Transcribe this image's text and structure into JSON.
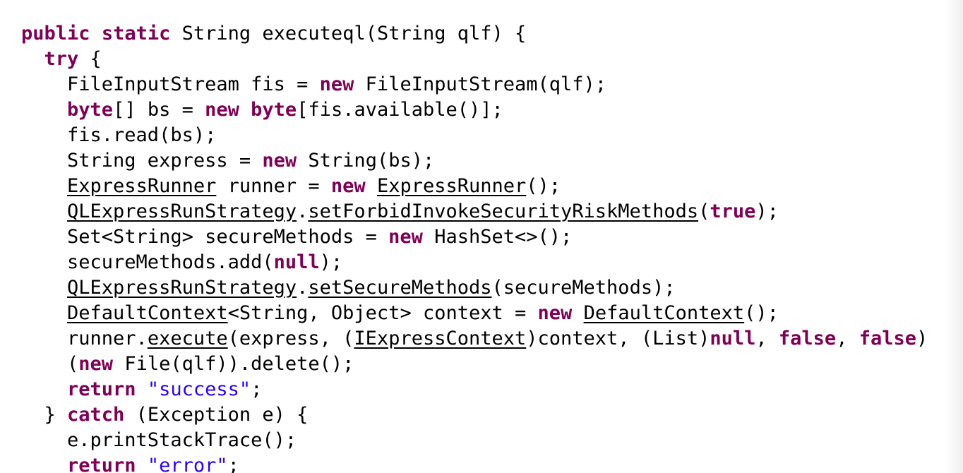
{
  "colors": {
    "keyword": "#7f0055",
    "string": "#2a00ff",
    "text": "#000000",
    "background": "#ffffff"
  },
  "code": {
    "lines": [
      [
        {
          "t": "public",
          "c": "kw"
        },
        {
          "t": " "
        },
        {
          "t": "static",
          "c": "kw"
        },
        {
          "t": " String executeql(String qlf) {"
        }
      ],
      [
        {
          "t": "  "
        },
        {
          "t": "try",
          "c": "kw"
        },
        {
          "t": " {"
        }
      ],
      [
        {
          "t": "    FileInputStream fis = "
        },
        {
          "t": "new",
          "c": "kw"
        },
        {
          "t": " FileInputStream(qlf);"
        }
      ],
      [
        {
          "t": "    "
        },
        {
          "t": "byte",
          "c": "kw"
        },
        {
          "t": "[] bs = "
        },
        {
          "t": "new",
          "c": "kw"
        },
        {
          "t": " "
        },
        {
          "t": "byte",
          "c": "kw"
        },
        {
          "t": "[fis.available()];"
        }
      ],
      [
        {
          "t": "    fis.read(bs);"
        }
      ],
      [
        {
          "t": "    String express = "
        },
        {
          "t": "new",
          "c": "kw"
        },
        {
          "t": " String(bs);"
        }
      ],
      [
        {
          "t": "    "
        },
        {
          "t": "ExpressRunner",
          "c": "ref"
        },
        {
          "t": " runner = "
        },
        {
          "t": "new",
          "c": "kw"
        },
        {
          "t": " "
        },
        {
          "t": "ExpressRunner",
          "c": "ref"
        },
        {
          "t": "();"
        }
      ],
      [
        {
          "t": "    "
        },
        {
          "t": "QLExpressRunStrategy",
          "c": "ref"
        },
        {
          "t": "."
        },
        {
          "t": "setForbidInvokeSecurityRiskMethods",
          "c": "ref"
        },
        {
          "t": "("
        },
        {
          "t": "true",
          "c": "kw"
        },
        {
          "t": ");"
        }
      ],
      [
        {
          "t": "    Set<String> secureMethods = "
        },
        {
          "t": "new",
          "c": "kw"
        },
        {
          "t": " HashSet<>();"
        }
      ],
      [
        {
          "t": "    secureMethods.add("
        },
        {
          "t": "null",
          "c": "kw"
        },
        {
          "t": ");"
        }
      ],
      [
        {
          "t": "    "
        },
        {
          "t": "QLExpressRunStrategy",
          "c": "ref"
        },
        {
          "t": "."
        },
        {
          "t": "setSecureMethods",
          "c": "ref"
        },
        {
          "t": "(secureMethods);"
        }
      ],
      [
        {
          "t": "    "
        },
        {
          "t": "DefaultContext",
          "c": "ref"
        },
        {
          "t": "<String, Object> context = "
        },
        {
          "t": "new",
          "c": "kw"
        },
        {
          "t": " "
        },
        {
          "t": "DefaultContext",
          "c": "ref"
        },
        {
          "t": "();"
        }
      ],
      [
        {
          "t": "    runner."
        },
        {
          "t": "execute",
          "c": "ref"
        },
        {
          "t": "(express, ("
        },
        {
          "t": "IExpressContext",
          "c": "ref"
        },
        {
          "t": ")context, (List)"
        },
        {
          "t": "null",
          "c": "kw"
        },
        {
          "t": ", "
        },
        {
          "t": "false",
          "c": "kw"
        },
        {
          "t": ", "
        },
        {
          "t": "false",
          "c": "kw"
        },
        {
          "t": ")"
        }
      ],
      [
        {
          "t": "    ("
        },
        {
          "t": "new",
          "c": "kw"
        },
        {
          "t": " File(qlf)).delete();"
        }
      ],
      [
        {
          "t": "    "
        },
        {
          "t": "return",
          "c": "kw"
        },
        {
          "t": " "
        },
        {
          "t": "\"success\"",
          "c": "str"
        },
        {
          "t": ";"
        }
      ],
      [
        {
          "t": "  } "
        },
        {
          "t": "catch",
          "c": "kw"
        },
        {
          "t": " (Exception e) {"
        }
      ],
      [
        {
          "t": "    e.printStackTrace();"
        }
      ],
      [
        {
          "t": "    "
        },
        {
          "t": "return",
          "c": "kw"
        },
        {
          "t": " "
        },
        {
          "t": "\"error\"",
          "c": "str"
        },
        {
          "t": ";"
        }
      ]
    ]
  }
}
